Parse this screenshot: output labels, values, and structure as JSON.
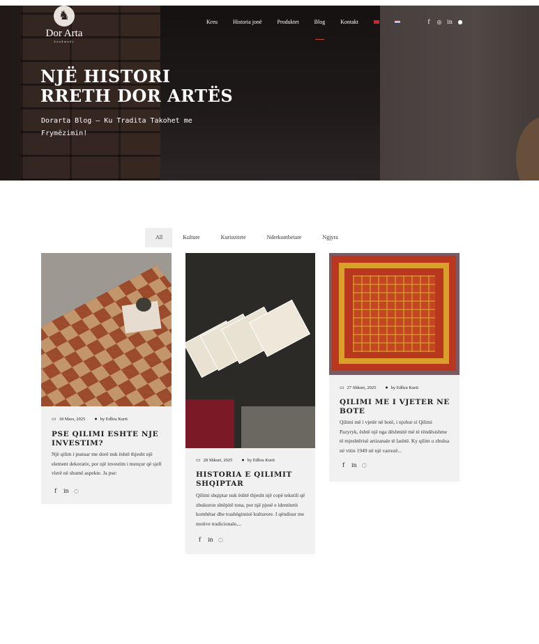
{
  "header": {
    "logo_text": "Dor Arta",
    "logo_subtext": "handmade",
    "nav": [
      {
        "label": "Kreu"
      },
      {
        "label": "Historia jonë"
      },
      {
        "label": "Produktet"
      },
      {
        "label": "Blog",
        "active": true
      },
      {
        "label": "Kontakt"
      }
    ],
    "languages": [
      "al-flag-icon",
      "hr-flag-icon"
    ],
    "socials": [
      "facebook-icon",
      "instagram-icon",
      "linkedin-icon",
      "pinterest-icon"
    ]
  },
  "hero": {
    "title": "NJË HISTORI RRETH DOR ARTËS",
    "subtitle": "Dorarta Blog – Ku Tradita Takohet me Frymëzimin!"
  },
  "filters": [
    {
      "label": "All",
      "active": true
    },
    {
      "label": "Kulture"
    },
    {
      "label": "Kuriozitete"
    },
    {
      "label": "Nderkombetare"
    },
    {
      "label": "Ngjyra"
    }
  ],
  "posts": [
    {
      "date": "18 Mars, 2025",
      "author": "by Edlira Kurti",
      "title": "PSE QILIMI ESHTE NJE INVESTIM?",
      "excerpt": "Një qilim i punuar me dorë nuk është thjesht një element dekorativ, por një investim i mençur që sjell vlerë në shumë aspekte. Ja pse:"
    },
    {
      "date": "28 Shkurt, 2025",
      "author": "by Edlira Kurti",
      "title": "HISTORIA E QILIMIT SHQIPTAR",
      "excerpt": "Qilimi shqiptar nuk është thjesht një copë tekstili që zbukuron shtëpitë tona, por një pjesë e identitetit kombëtar dhe trashëgimisë kulturore. I qëndisur me motive tradicionale,..."
    },
    {
      "date": "27 Shkurt, 2025",
      "author": "by Edlira Kurti",
      "title": "QILIMI ME I VJETER NE BOTE",
      "excerpt": "Qilimi më i vjetër në botë, i njohur si Qilimi Pazyryk, është një nga dëshmitë më të rëndësishme të mjeshtërisë artizanale të lashtë. Ky qilim u zbulua në vitin 1949 në një varrezë..."
    }
  ],
  "colors": {
    "accent": "#c8453a",
    "card_bg": "#f1f1f1",
    "filter_active_bg": "#eeeeee"
  }
}
